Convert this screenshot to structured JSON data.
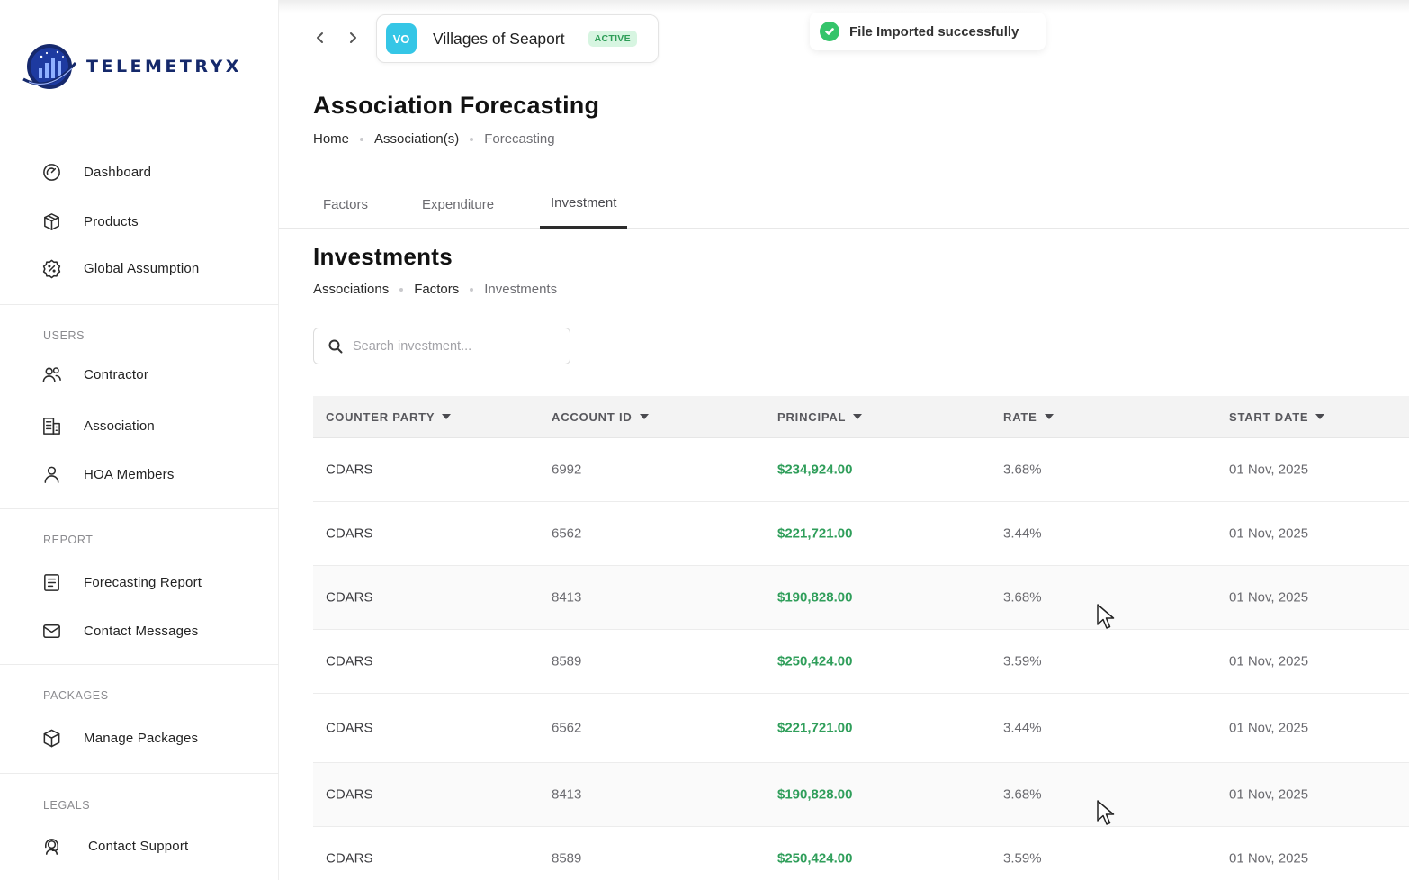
{
  "brand": {
    "name": "TELEMETRYX"
  },
  "sidebar": {
    "main_items": [
      {
        "label": "Dashboard",
        "icon": "gauge-icon"
      },
      {
        "label": "Products",
        "icon": "box-icon"
      },
      {
        "label": "Global Assumption",
        "icon": "percent-badge-icon"
      }
    ],
    "sections": [
      {
        "label": "USERS",
        "items": [
          {
            "label": "Contractor",
            "icon": "users-icon"
          },
          {
            "label": "Association",
            "icon": "building-icon"
          },
          {
            "label": "HOA Members",
            "icon": "user-icon"
          }
        ]
      },
      {
        "label": "REPORT",
        "items": [
          {
            "label": "Forecasting Report",
            "icon": "document-icon"
          },
          {
            "label": "Contact Messages",
            "icon": "mail-icon"
          }
        ]
      },
      {
        "label": "PACKAGES",
        "items": [
          {
            "label": "Manage Packages",
            "icon": "cube-icon"
          }
        ]
      },
      {
        "label": "LEGALS",
        "items": [
          {
            "label": "Contact Support",
            "icon": "support-icon"
          }
        ]
      }
    ]
  },
  "header": {
    "association": {
      "initials": "VO",
      "name": "Villages of Seaport",
      "status": "ACTIVE",
      "avatar_color": "#35c6e6"
    },
    "toast": "File Imported successfully"
  },
  "page": {
    "title": "Association Forecasting",
    "breadcrumb": [
      "Home",
      "Association(s)",
      "Forecasting"
    ]
  },
  "tabs": [
    {
      "label": "Factors",
      "active": false
    },
    {
      "label": "Expenditure",
      "active": false
    },
    {
      "label": "Investment",
      "active": true
    }
  ],
  "investments": {
    "title": "Investments",
    "breadcrumb": [
      "Associations",
      "Factors",
      "Investments"
    ],
    "search": {
      "placeholder": "Search investment...",
      "value": ""
    },
    "columns": [
      "COUNTER PARTY",
      "ACCOUNT ID",
      "PRINCIPAL",
      "RATE",
      "START DATE"
    ],
    "rows": [
      [
        "CDARS",
        "6992",
        "$234,924.00",
        "3.68%",
        "01 Nov, 2025"
      ],
      [
        "CDARS",
        "6562",
        "$221,721.00",
        "3.44%",
        "01 Nov, 2025"
      ],
      [
        "CDARS",
        "8413",
        "$190,828.00",
        "3.68%",
        "01 Nov, 2025"
      ],
      [
        "CDARS",
        "8589",
        "$250,424.00",
        "3.59%",
        "01 Nov, 2025"
      ],
      [
        "CDARS",
        "6562",
        "$221,721.00",
        "3.44%",
        "01 Nov, 2025"
      ],
      [
        "CDARS",
        "8413",
        "$190,828.00",
        "3.68%",
        "01 Nov, 2025"
      ],
      [
        "CDARS",
        "8589",
        "$250,424.00",
        "3.59%",
        "01 Nov, 2025"
      ]
    ]
  },
  "colors": {
    "brand": "#15296b",
    "money": "#2f9e5a",
    "success": "#34c46a",
    "active_badge_bg": "#d7f5e1"
  }
}
